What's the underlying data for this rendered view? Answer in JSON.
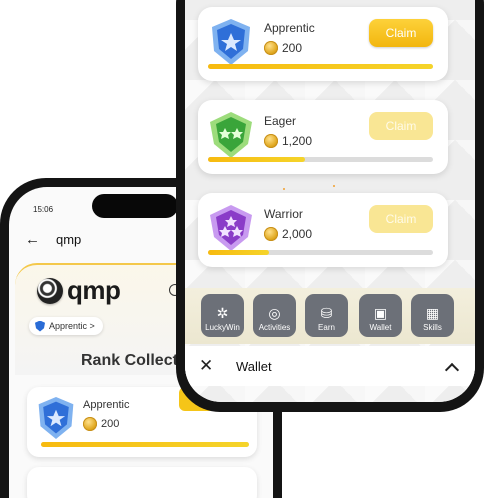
{
  "back_phone": {
    "status_time": "15:06",
    "nav_title": "qmp",
    "logo_text": "qmp",
    "rank_pill_label": "Apprentic >",
    "section_heading": "Rank Collect",
    "card": {
      "name": "Apprentic",
      "coins": "200",
      "progress": 1.0
    }
  },
  "front_phone": {
    "ranks": [
      {
        "name": "Apprentic",
        "coins": "200",
        "claim_label": "Claim",
        "claim_active": true,
        "progress": 1.0,
        "badge_color": "#2f6fd8"
      },
      {
        "name": "Eager",
        "coins": "1,200",
        "claim_label": "Claim",
        "claim_active": false,
        "progress": 0.43,
        "badge_color": "#3aa53a"
      },
      {
        "name": "Warrior",
        "coins": "2,000",
        "claim_label": "Claim",
        "claim_active": false,
        "progress": 0.27,
        "badge_color": "#8a3cc8"
      }
    ],
    "tools": [
      {
        "label": "LuckyWin",
        "icon": "pinwheel-icon"
      },
      {
        "label": "Activities",
        "icon": "target-icon"
      },
      {
        "label": "Earn",
        "icon": "coins-icon"
      },
      {
        "label": "Wallet",
        "icon": "wallet-icon"
      },
      {
        "label": "Skills",
        "icon": "grid-icon"
      }
    ],
    "bottom_bar": {
      "title": "Wallet"
    }
  },
  "colors": {
    "accent": "#f5c518",
    "claim_dim": "#f9e694",
    "tool_bg": "#6c7078"
  }
}
